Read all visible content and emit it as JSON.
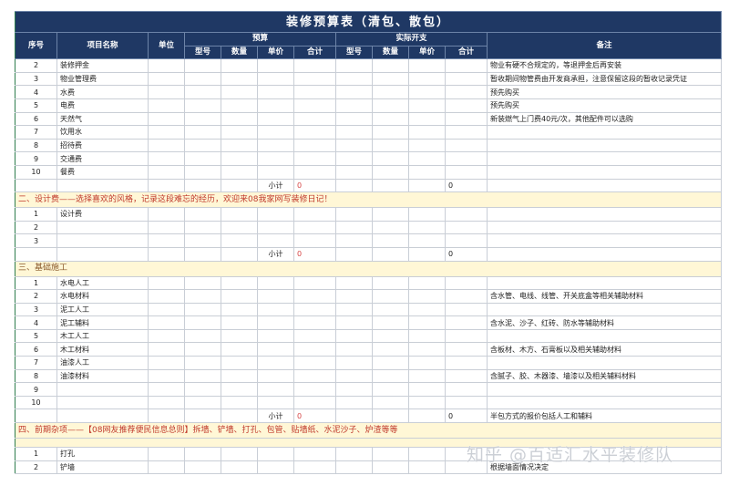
{
  "title": "装修预算表（清包、散包）",
  "columns": {
    "no": "序号",
    "item": "项目名称",
    "unit": "单位",
    "budget": "预算",
    "actual": "实际开支",
    "model": "型号",
    "qty": "数量",
    "price": "单价",
    "total": "合计",
    "remark": "备注"
  },
  "group1_rows": [
    {
      "no": "2",
      "name": "装修押金",
      "remark": "物业有硬不合规定的，等退押金后再安装"
    },
    {
      "no": "3",
      "name": "物业管理费",
      "remark": "暂收期间物管费由开发商承担，注意保留这段的暂收记录凭证"
    },
    {
      "no": "4",
      "name": "水费",
      "remark": "预先购买"
    },
    {
      "no": "5",
      "name": "电费",
      "remark": "预先购买"
    },
    {
      "no": "6",
      "name": "天然气",
      "remark": "新装燃气上门费40元/次，其他配件可以选购"
    },
    {
      "no": "7",
      "name": "饮用水",
      "remark": ""
    },
    {
      "no": "8",
      "name": "招待费",
      "remark": ""
    },
    {
      "no": "9",
      "name": "交通费",
      "remark": ""
    },
    {
      "no": "10",
      "name": "餐费",
      "remark": ""
    }
  ],
  "subtotal_label": "小计",
  "subtotal_budget": "0",
  "subtotal_actual": "0",
  "section2": {
    "title": "二、设计费——选择喜欢的风格，记录这段难忘的经历，欢迎来08我家网写装修日记！",
    "rows": [
      {
        "no": "1",
        "name": "设计费",
        "remark": ""
      },
      {
        "no": "2",
        "name": "",
        "remark": ""
      },
      {
        "no": "3",
        "name": "",
        "remark": ""
      }
    ]
  },
  "section3": {
    "title": "三、基础施工",
    "rows": [
      {
        "no": "1",
        "name": "水电人工",
        "remark": ""
      },
      {
        "no": "2",
        "name": "水电材料",
        "remark": "含水管、电线、线管、开关底盒等相关辅助材料"
      },
      {
        "no": "3",
        "name": "泥工人工",
        "remark": ""
      },
      {
        "no": "4",
        "name": "泥工辅料",
        "remark": "含水泥、沙子、红砖、防水等辅助材料"
      },
      {
        "no": "5",
        "name": "木工人工",
        "remark": ""
      },
      {
        "no": "6",
        "name": "木工材料",
        "remark": "含板材、木方、石膏板以及相关辅助材料"
      },
      {
        "no": "7",
        "name": "油漆人工",
        "remark": ""
      },
      {
        "no": "8",
        "name": "油漆材料",
        "remark": "含腻子、胶、木器漆、墙漆以及相关辅料材料"
      },
      {
        "no": "9",
        "name": "",
        "remark": ""
      },
      {
        "no": "10",
        "name": "",
        "remark": ""
      }
    ],
    "subtotal_remark": "半包方式的报价包括人工和辅料"
  },
  "section4": {
    "title": "四、前期杂项——【08网友推荐便民信息总则】拆墙、铲墙、打孔、包管、贴墙纸、水泥沙子、炉渣等等",
    "rows": [
      {
        "no": "1",
        "name": "打孔",
        "remark": ""
      },
      {
        "no": "2",
        "name": "铲墙",
        "remark": "根据墙面情况决定"
      }
    ]
  },
  "watermark": "知乎 @百适汇水平装修队"
}
